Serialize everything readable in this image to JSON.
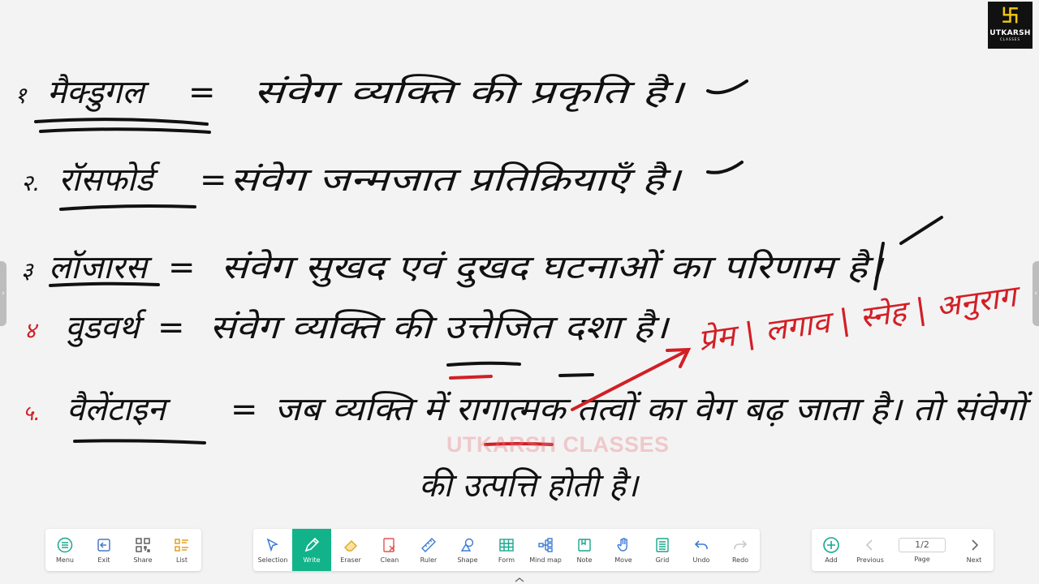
{
  "brand": {
    "name": "UTKARSH",
    "subname": "CLASSES",
    "watermark": "UTKARSH CLASSES"
  },
  "board": {
    "lines": [
      {
        "bullet": "१",
        "term": "मैक्डुगल",
        "sep": "=",
        "text": "संवेग व्यक्ति की प्रकृति है।"
      },
      {
        "bullet": "२.",
        "term": "रॉसफोर्ड",
        "sep": "=",
        "text": "संवेग जन्मजात प्रतिक्रियाएँ है।"
      },
      {
        "bullet": "३",
        "term": "लॉजारस",
        "sep": "=",
        "text": "संवेग सुखद एवं दुखद घटनाओं का परिणाम है।"
      },
      {
        "bullet": "४",
        "term": "वुडवर्थ",
        "sep": "=",
        "text": "संवेग व्यक्ति की उत्तेजित दशा है।"
      },
      {
        "bullet": "५.",
        "term": "वैलेंटाइन",
        "sep": "=",
        "text": "जब व्यक्ति में रागात्मक तत्वों का वेग बढ़ जाता है। तो संवेगों"
      },
      {
        "bullet": "",
        "term": "",
        "sep": "",
        "text": "की उत्पत्ति होती है।"
      }
    ],
    "annotation": "प्रेम | लगाव | स्नेह | अनुराग"
  },
  "toolbars": {
    "left": [
      {
        "label": "Menu",
        "icon": "menu-icon"
      },
      {
        "label": "Exit",
        "icon": "exit-icon"
      },
      {
        "label": "Share",
        "icon": "qr-share-icon"
      },
      {
        "label": "List",
        "icon": "list-icon"
      }
    ],
    "center": [
      {
        "label": "Selection",
        "icon": "cursor-icon"
      },
      {
        "label": "Write",
        "icon": "pen-icon",
        "active": true
      },
      {
        "label": "Eraser",
        "icon": "eraser-icon"
      },
      {
        "label": "Clean",
        "icon": "clean-icon"
      },
      {
        "label": "Ruler",
        "icon": "ruler-icon"
      },
      {
        "label": "Shape",
        "icon": "shape-icon"
      },
      {
        "label": "Form",
        "icon": "table-icon"
      },
      {
        "label": "Mind map",
        "icon": "mindmap-icon"
      },
      {
        "label": "Note",
        "icon": "note-icon"
      },
      {
        "label": "Move",
        "icon": "hand-icon"
      },
      {
        "label": "Grid",
        "icon": "grid-icon"
      },
      {
        "label": "Undo",
        "icon": "undo-icon"
      },
      {
        "label": "Redo",
        "icon": "redo-icon"
      }
    ],
    "right": {
      "add_label": "Add",
      "previous_label": "Previous",
      "page_value": "1/2",
      "page_label": "Page",
      "next_label": "Next"
    }
  },
  "colors": {
    "ink": "#111111",
    "red_ink": "#d21f26",
    "accent": "#12b38a",
    "background": "#f3f3f3"
  }
}
